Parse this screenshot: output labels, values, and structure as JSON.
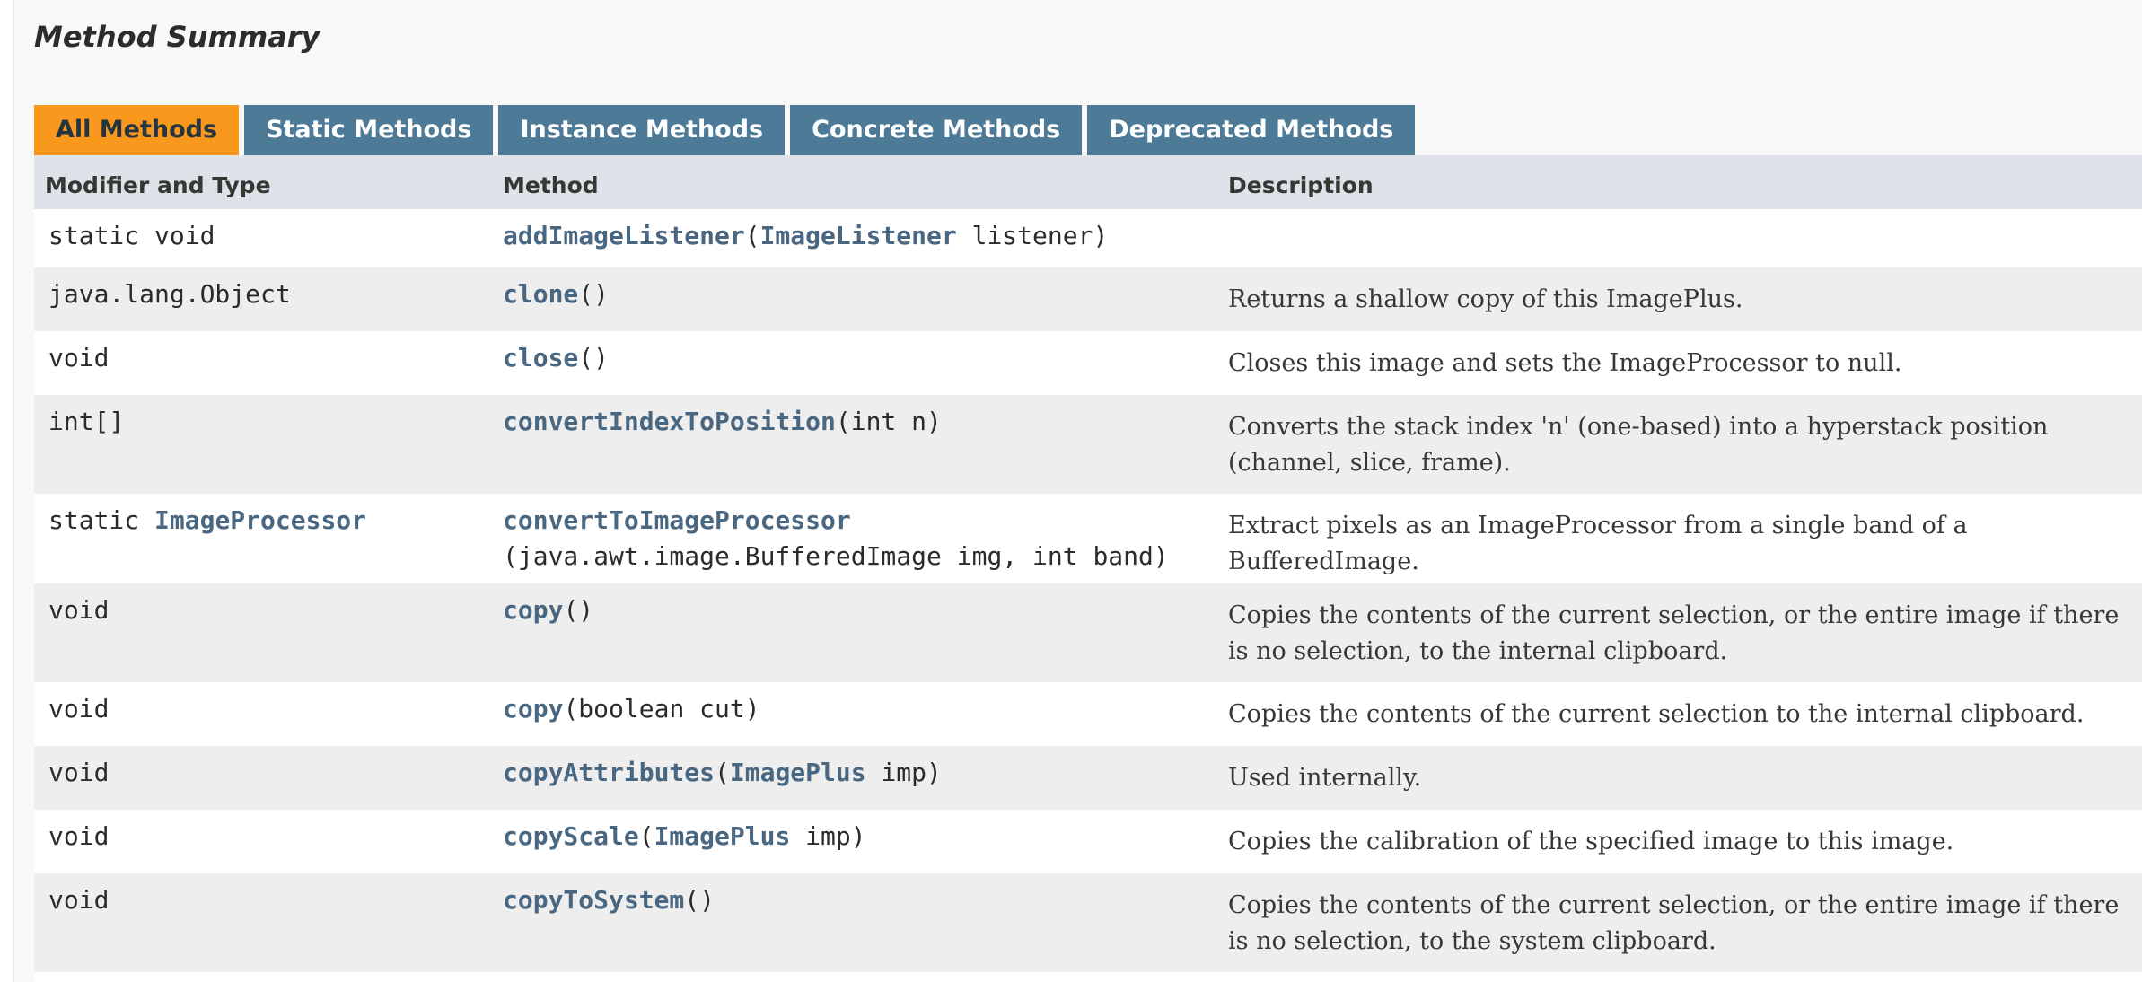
{
  "section": {
    "title": "Method Summary"
  },
  "tabs": [
    {
      "label": "All Methods",
      "active": true
    },
    {
      "label": "Static Methods",
      "active": false
    },
    {
      "label": "Instance Methods",
      "active": false
    },
    {
      "label": "Concrete Methods",
      "active": false
    },
    {
      "label": "Deprecated Methods",
      "active": false
    }
  ],
  "table": {
    "headers": {
      "modifier": "Modifier and Type",
      "method": "Method",
      "description": "Description"
    },
    "rows": [
      {
        "modifier_prefix": "static void",
        "modifier_link": "",
        "method_name": "addImageListener",
        "method_open": "(",
        "param_link": "ImageListener",
        "params": " listener)",
        "params_line2": "",
        "description": ""
      },
      {
        "modifier_prefix": "java.lang.Object",
        "modifier_link": "",
        "method_name": "clone",
        "method_open": "()",
        "param_link": "",
        "params": "",
        "params_line2": "",
        "description": "Returns a shallow copy of this ImagePlus."
      },
      {
        "modifier_prefix": "void",
        "modifier_link": "",
        "method_name": "close",
        "method_open": "()",
        "param_link": "",
        "params": "",
        "params_line2": "",
        "description": "Closes this image and sets the ImageProcessor to null."
      },
      {
        "modifier_prefix": "int[]",
        "modifier_link": "",
        "method_name": "convertIndexToPosition",
        "method_open": "(int n)",
        "param_link": "",
        "params": "",
        "params_line2": "",
        "description": "Converts the stack index 'n' (one-based) into a hyperstack position (channel, slice, frame)."
      },
      {
        "modifier_prefix": "static ",
        "modifier_link": "ImageProcessor",
        "method_name": "convertToImageProcessor",
        "method_open": "",
        "param_link": "",
        "params": "",
        "params_line2": "(java.awt.image.BufferedImage img, int band)",
        "description": "Extract pixels as an ImageProcessor from a single band of a BufferedImage."
      },
      {
        "modifier_prefix": "void",
        "modifier_link": "",
        "method_name": "copy",
        "method_open": "()",
        "param_link": "",
        "params": "",
        "params_line2": "",
        "description": "Copies the contents of the current selection, or the entire image if there is no selection, to the internal clipboard."
      },
      {
        "modifier_prefix": "void",
        "modifier_link": "",
        "method_name": "copy",
        "method_open": "(boolean cut)",
        "param_link": "",
        "params": "",
        "params_line2": "",
        "description": "Copies the contents of the current selection to the internal clipboard."
      },
      {
        "modifier_prefix": "void",
        "modifier_link": "",
        "method_name": "copyAttributes",
        "method_open": "(",
        "param_link": "ImagePlus",
        "params": " imp)",
        "params_line2": "",
        "description": "Used internally."
      },
      {
        "modifier_prefix": "void",
        "modifier_link": "",
        "method_name": "copyScale",
        "method_open": "(",
        "param_link": "ImagePlus",
        "params": " imp)",
        "params_line2": "",
        "description": "Copies the calibration of the specified image to this image."
      },
      {
        "modifier_prefix": "void",
        "modifier_link": "",
        "method_name": "copyToSystem",
        "method_open": "()",
        "param_link": "",
        "params": "",
        "params_line2": "",
        "description": "Copies the contents of the current selection, or the entire image if there is no selection, to the system clipboard."
      }
    ]
  }
}
